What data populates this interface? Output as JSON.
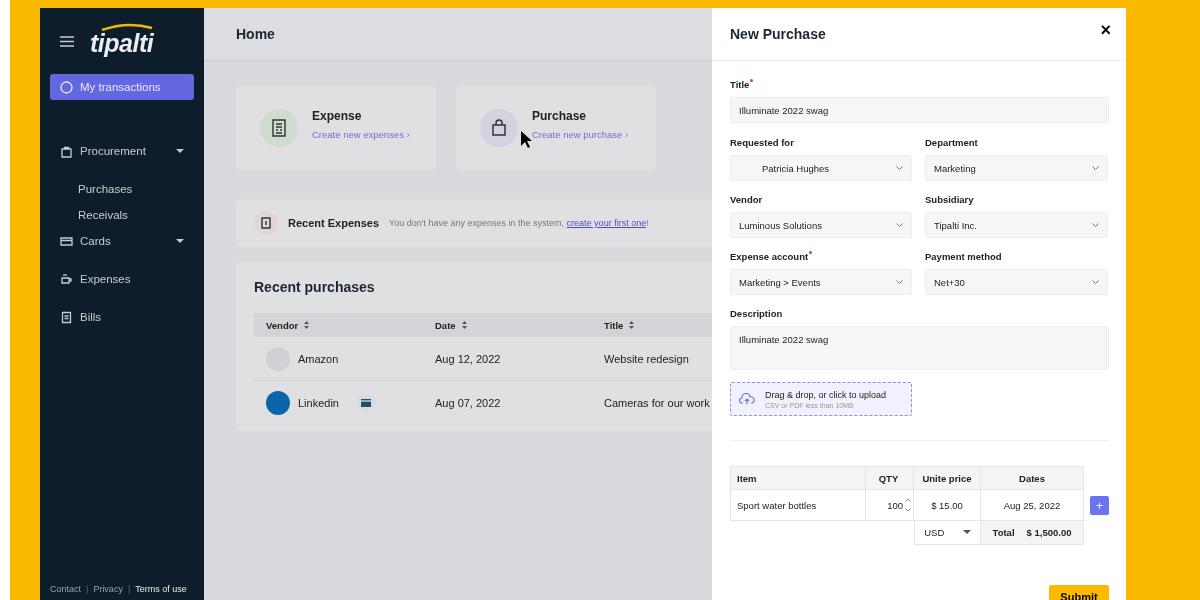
{
  "sidebar": {
    "logo": "tipalti",
    "items": [
      {
        "label": "My transactions",
        "selected": true,
        "dropdown": false
      },
      {
        "label": "Procurement",
        "selected": false,
        "dropdown": true,
        "children": [
          {
            "label": "Purchases"
          },
          {
            "label": "Receivals"
          }
        ]
      },
      {
        "label": "Cards",
        "selected": false,
        "dropdown": true
      },
      {
        "label": "Expenses",
        "selected": false,
        "dropdown": false
      },
      {
        "label": "Bills",
        "selected": false,
        "dropdown": false
      }
    ],
    "footer": [
      {
        "label": "Contact",
        "bold": false
      },
      {
        "label": "|",
        "kind": "sep"
      },
      {
        "label": "Privacy",
        "bold": false
      },
      {
        "label": "|",
        "kind": "sep"
      },
      {
        "label": "Terms of use",
        "bold": true
      }
    ]
  },
  "main": {
    "title": "Home",
    "cards": [
      {
        "title": "Expense",
        "link": "Create new expenses ›"
      },
      {
        "title": "Purchase",
        "link": "Create new purchase ›"
      }
    ],
    "recent_expenses": {
      "title": "Recent Expenses",
      "text": "You don't have any expenses in the system,",
      "link": "create your first one",
      "end": "!"
    },
    "recent_purchases": {
      "title": "Recent purchases",
      "columns": [
        "Vendor",
        "Date",
        "Title"
      ],
      "rows": [
        {
          "vendor": "Amazon",
          "avatar": false,
          "card": false,
          "date": "Aug 12, 2022",
          "title": "Website redesign"
        },
        {
          "vendor": "Linkedin",
          "avatar": true,
          "card": true,
          "date": "Aug 07, 2022",
          "title": "Cameras for our work"
        }
      ]
    }
  },
  "panel": {
    "title": "New Purchase",
    "close": "×",
    "title_field": {
      "label": "Title",
      "required": true,
      "value": "Illuminate 2022 swag"
    },
    "fields": [
      {
        "label": "Requested for",
        "required": false,
        "value": "Patricia Hughes"
      },
      {
        "label": "Department",
        "required": false,
        "value": "Marketing"
      },
      {
        "label": "Vendor",
        "required": false,
        "value": "Luminous Solutions"
      },
      {
        "label": "Subsidiary",
        "required": false,
        "value": "Tipalti Inc."
      },
      {
        "label": "Expense account",
        "required": true,
        "value": "Marketing > Events"
      },
      {
        "label": "Payment method",
        "required": false,
        "value": "Net+30"
      }
    ],
    "description": {
      "label": "Description",
      "value": "Illuminate 2022 swag"
    },
    "upload": {
      "title": "Drag & drop, or click to upload",
      "hint": "CSV or PDF less than 10MB"
    },
    "items": {
      "columns": [
        "Item",
        "QTY",
        "Unite price",
        "Dates"
      ],
      "rows": [
        {
          "item": "Sport water bottles",
          "qty": "100",
          "price": "$ 15.00",
          "date": "Aug 25, 2022"
        }
      ],
      "currency": "USD",
      "total_label": "Total",
      "total": "$ 1,500.00",
      "add": "+"
    },
    "submit": "Submit"
  }
}
